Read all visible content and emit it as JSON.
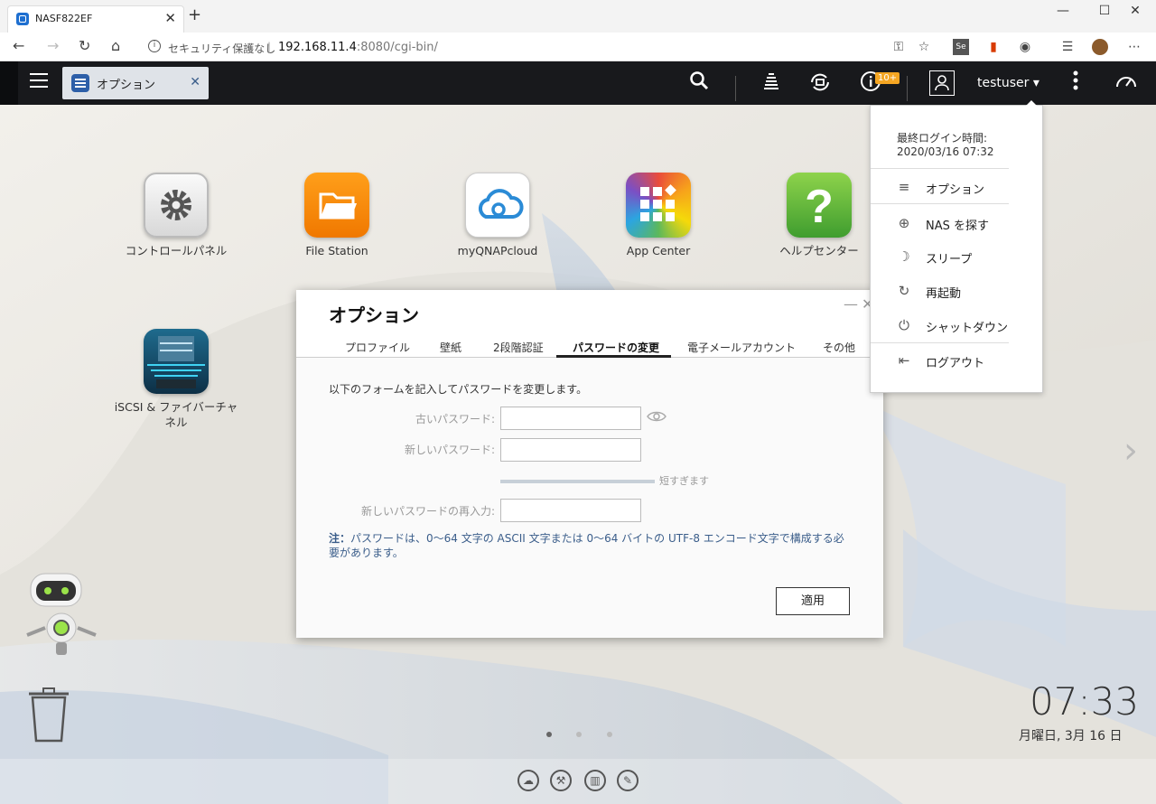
{
  "browser": {
    "tab_title": "NASF822EF",
    "tab_close": "✕",
    "new_tab": "+",
    "security_label": "セキュリティ保護なし",
    "separator": "|",
    "url_host": "192.168.11.4",
    "url_rest": ":8080/cgi-bin/",
    "window_controls": [
      "—",
      "☐",
      "✕"
    ]
  },
  "nas_topbar": {
    "app_tab_label": "オプション",
    "app_tab_close": "✕",
    "notification_badge": "10+",
    "username": "testuser ▾"
  },
  "desktop_apps": [
    {
      "label": "コントロールパネル",
      "icon": "gear-icon"
    },
    {
      "label": "File Station",
      "icon": "folder-icon"
    },
    {
      "label": "myQNAPcloud",
      "icon": "cloud-icon"
    },
    {
      "label": "App Center",
      "icon": "grid-icon"
    },
    {
      "label": "ヘルプセンター",
      "icon": "question-icon"
    },
    {
      "label": "iSCSI & ファイバーチャネル",
      "icon": "storage-icon"
    }
  ],
  "dialog": {
    "title": "オプション",
    "tabs": [
      "プロファイル",
      "壁紙",
      "2段階認証",
      "パスワードの変更",
      "電子メールアカウント",
      "その他"
    ],
    "active_tab": "パスワードの変更",
    "description": "以下のフォームを記入してパスワードを変更します。",
    "old_password_label": "古いパスワード:",
    "new_password_label": "新しいパスワード:",
    "strength_text": "短すぎます",
    "confirm_password_label": "新しいパスワードの再入力:",
    "note_prefix": "注：",
    "note_text": "パスワードは、0〜64 文字の ASCII 文字または 0〜64 バイトの UTF-8 エンコード文字で構成する必要があります。",
    "apply_label": "適用"
  },
  "user_menu": {
    "last_login_label": "最終ログイン時間:",
    "last_login_time": "2020/03/16 07:32",
    "items": [
      {
        "label": "オプション",
        "icon": "sliders-icon"
      },
      {
        "label": "NAS を探す",
        "icon": "crosshair-icon"
      },
      {
        "label": "スリープ",
        "icon": "moon-icon"
      },
      {
        "label": "再起動",
        "icon": "restart-icon"
      },
      {
        "label": "シャットダウン",
        "icon": "power-icon"
      },
      {
        "label": "ログアウト",
        "icon": "logout-icon"
      }
    ]
  },
  "clock": {
    "time": "07:33",
    "date": "月曜日, 3月 16 日"
  },
  "colors": {
    "topbar": "#18191c",
    "accent": "#3a5d8a",
    "badge": "#f5a623"
  }
}
